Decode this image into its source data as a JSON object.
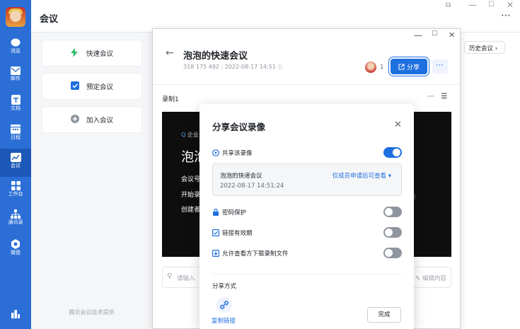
{
  "app": {
    "title": "会议"
  },
  "rail": {
    "items": [
      {
        "label": "消息",
        "icon": "chat-bubble-icon"
      },
      {
        "label": "邮件",
        "icon": "mail-icon"
      },
      {
        "label": "文档",
        "icon": "document-icon"
      },
      {
        "label": "日程",
        "icon": "calendar-icon"
      },
      {
        "label": "会议",
        "icon": "meeting-icon",
        "active": true
      },
      {
        "label": "工作台",
        "icon": "grid-icon"
      },
      {
        "label": "通讯录",
        "icon": "org-chart-icon"
      },
      {
        "label": "微盘",
        "icon": "cloud-disk-icon"
      }
    ]
  },
  "panel": {
    "quick_meeting": "快速会议",
    "schedule_meeting": "预定会议",
    "join_meeting": "加入会议",
    "footer": "腾讯会议技术提供"
  },
  "main": {
    "history": "历史会议"
  },
  "detail": {
    "title": "泡泡的快速会议",
    "meeting_id": "318 175 492",
    "datetime": "2022-08-17 14:51",
    "participant_count": "1",
    "share_label": "分享",
    "recording_label": "录制1",
    "comment_placeholder": "请输入",
    "edit_content": "编辑内容",
    "video": {
      "logo_text": "企业",
      "big_text": "泡泡",
      "line1": "会议号",
      "line2": "开始录",
      "line3": "创建者"
    }
  },
  "dialog": {
    "title": "分享会议录像",
    "share_recording": "共享该录像",
    "share_recording_on": true,
    "recording_name": "泡泡的快速会议",
    "recording_time": "2022-08-17 14:51:24",
    "permission": "仅成员申请后可查看",
    "password": "密码保护",
    "password_on": false,
    "link_valid": "链接有效期",
    "link_valid_on": false,
    "allow_download": "允许查看方下载录制文件",
    "allow_download_on": false,
    "share_method": "分享方式",
    "copy_link": "复制链接",
    "done": "完成"
  },
  "colors": {
    "rail": "#2b6fd6",
    "accent": "#1e6fdf"
  }
}
